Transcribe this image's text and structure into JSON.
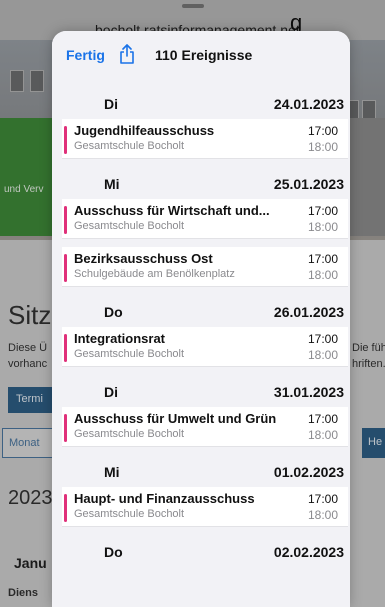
{
  "background": {
    "url": "bocholt.ratsinformanagement.net",
    "top_right_fragment": "g",
    "green_banner_text": "und Verv",
    "heading_fragment": "Sitz",
    "desc_left_1": "Diese Ü",
    "desc_left_2": "vorhanc",
    "desc_right_1": "Die führ",
    "desc_right_2": "hriften.",
    "termin_button": "Termi",
    "monat_field": "Monat",
    "he_button": "He",
    "year_fragment": "2023",
    "month_fragment": "Janu",
    "weekday_fragment": "Diens"
  },
  "sheet": {
    "done_label": "Fertig",
    "share_icon": "share-icon",
    "event_count": "110 Ereignisse",
    "accent_color": "#e0307a",
    "link_color": "#1a73e8"
  },
  "days": [
    {
      "weekday": "Di",
      "date": "24.01.2023",
      "events": [
        {
          "title": "Jugendhilfeausschuss",
          "location": "Gesamtschule Bocholt",
          "start": "17:00",
          "end": "18:00"
        }
      ]
    },
    {
      "weekday": "Mi",
      "date": "25.01.2023",
      "events": [
        {
          "title": "Ausschuss für Wirtschaft und...",
          "location": "Gesamtschule Bocholt",
          "start": "17:00",
          "end": "18:00"
        },
        {
          "title": "Bezirksausschuss Ost",
          "location": "Schulgebäude am Benölkenplatz",
          "start": "17:00",
          "end": "18:00"
        }
      ]
    },
    {
      "weekday": "Do",
      "date": "26.01.2023",
      "events": [
        {
          "title": "Integrationsrat",
          "location": "Gesamtschule Bocholt",
          "start": "17:00",
          "end": "18:00"
        }
      ]
    },
    {
      "weekday": "Di",
      "date": "31.01.2023",
      "events": [
        {
          "title": "Ausschuss für Umwelt und Grün",
          "location": "Gesamtschule Bocholt",
          "start": "17:00",
          "end": "18:00"
        }
      ]
    },
    {
      "weekday": "Mi",
      "date": "01.02.2023",
      "events": [
        {
          "title": "Haupt- und Finanzausschuss",
          "location": "Gesamtschule Bocholt",
          "start": "17:00",
          "end": "18:00"
        }
      ]
    },
    {
      "weekday": "Do",
      "date": "02.02.2023",
      "events": []
    }
  ]
}
